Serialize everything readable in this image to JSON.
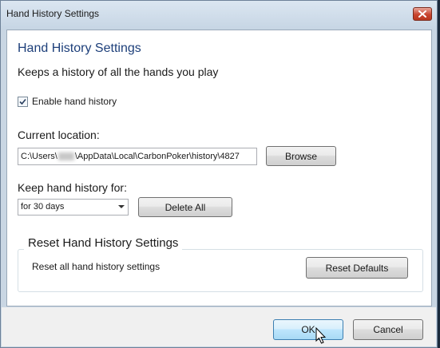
{
  "window": {
    "title": "Hand History Settings",
    "close_icon": "close-icon"
  },
  "content": {
    "heading": "Hand History Settings",
    "description": "Keeps a history of all the hands you play",
    "enable_checkbox": {
      "label": "Enable hand history",
      "checked": true
    },
    "location": {
      "label": "Current location:",
      "value_prefix": "C:\\Users\\",
      "value_suffix": "\\AppData\\Local\\CarbonPoker\\history\\4827",
      "browse_label": "Browse"
    },
    "keep": {
      "label": "Keep hand history for:",
      "selected": "for 30 days",
      "delete_label": "Delete All"
    },
    "reset_group": {
      "title": "Reset Hand History Settings",
      "description": "Reset all hand history settings",
      "button_label": "Reset Defaults"
    }
  },
  "footer": {
    "ok_label": "OK",
    "cancel_label": "Cancel"
  },
  "colors": {
    "heading": "#1d3f7a",
    "close_button": "#c8442f",
    "default_button_border": "#3c7fb1"
  }
}
